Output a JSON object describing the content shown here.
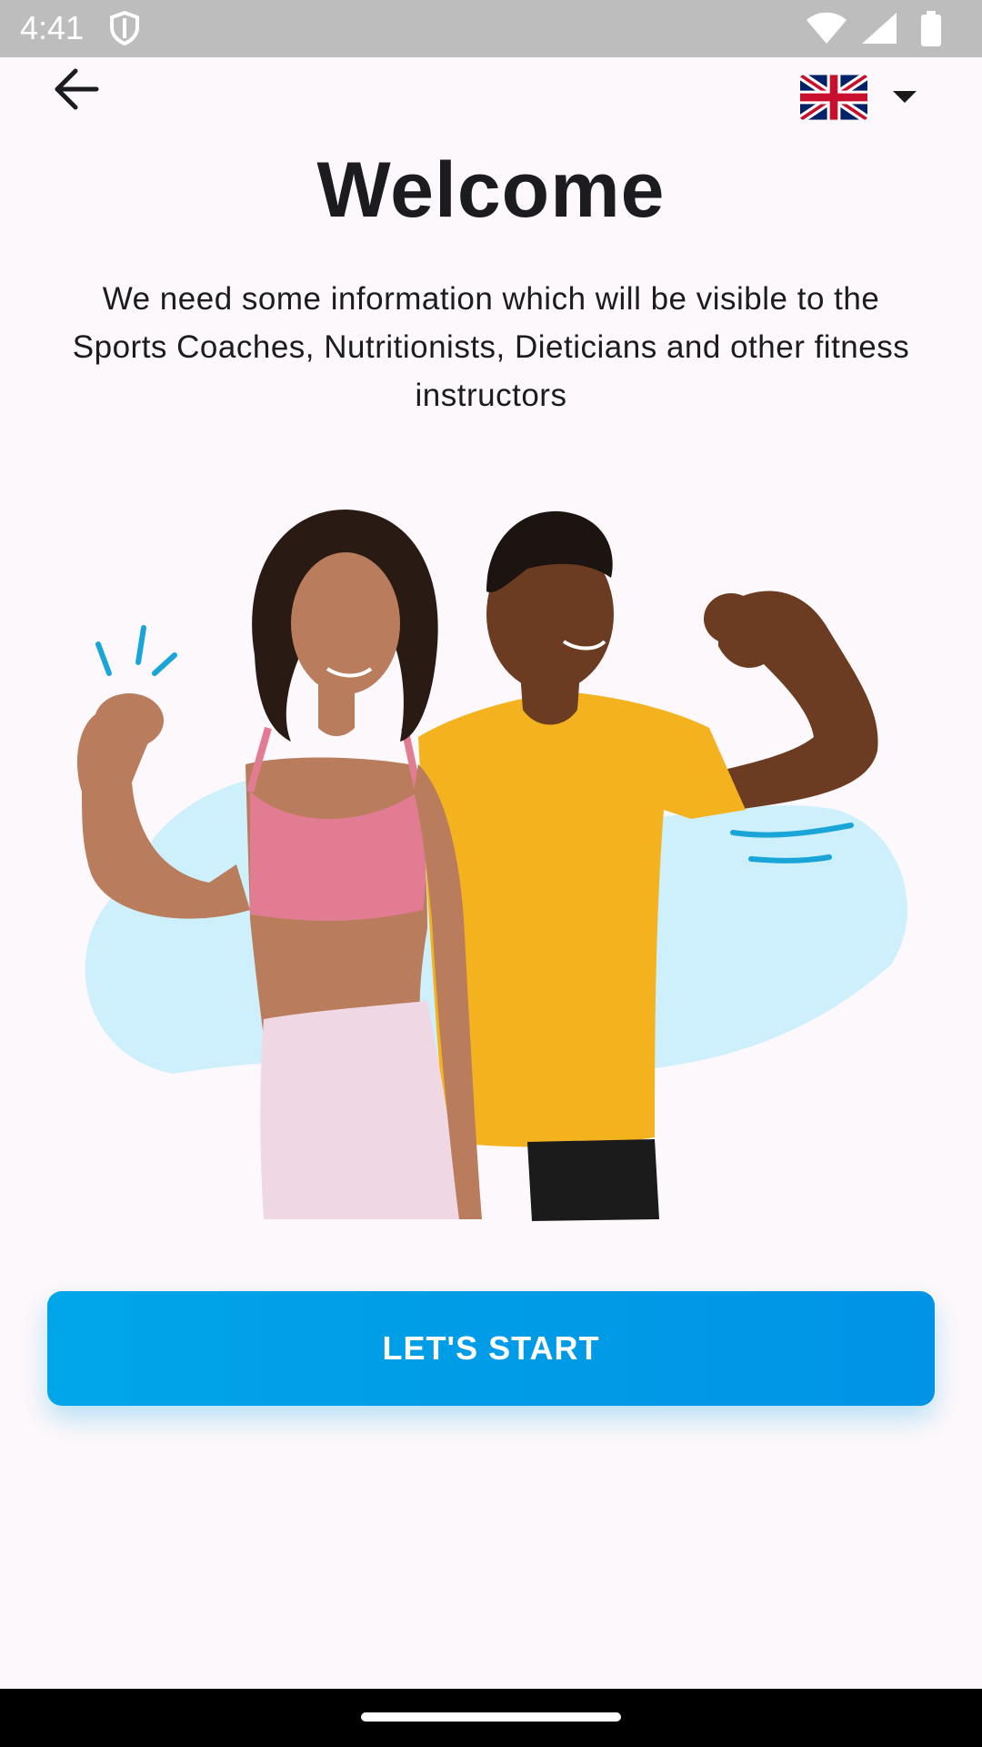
{
  "status_bar": {
    "time": "4:41",
    "icons": [
      "shield-icon",
      "wifi-icon",
      "cellular-signal-icon",
      "battery-icon"
    ]
  },
  "header": {
    "back_icon": "arrow-left-icon",
    "language_flag": "uk-flag-icon",
    "language_dropdown_icon": "caret-down-icon"
  },
  "welcome": {
    "title": "Welcome",
    "description": "We need some information which will be visible to the Sports Coaches, Nutritionists, Dieticians and other fitness instructors"
  },
  "illustration": {
    "subject": "fitness-couple-flexing-illustration"
  },
  "actions": {
    "start_label": "LET'S START"
  },
  "colors": {
    "background": "#fdf8fb",
    "accent": "#00a5e8",
    "blob": "#cdf0fc",
    "shirt": "#f3b21e",
    "top": "#e27c93",
    "title": "#1c1b1f"
  }
}
